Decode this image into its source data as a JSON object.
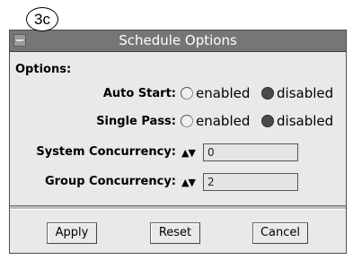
{
  "callout": "3c",
  "window": {
    "title": "Schedule Options",
    "options_label": "Options:",
    "auto_start": {
      "label": "Auto Start:",
      "enabled": "enabled",
      "disabled": "disabled",
      "selected": "disabled"
    },
    "single_pass": {
      "label": "Single Pass:",
      "enabled": "enabled",
      "disabled": "disabled",
      "selected": "disabled"
    },
    "system_concurrency": {
      "label": "System Concurrency:",
      "arrows": "▲▼",
      "value": "0"
    },
    "group_concurrency": {
      "label": "Group Concurrency:",
      "arrows": "▲▼",
      "value": "2"
    },
    "buttons": {
      "apply": "Apply",
      "reset": "Reset",
      "cancel": "Cancel"
    }
  }
}
